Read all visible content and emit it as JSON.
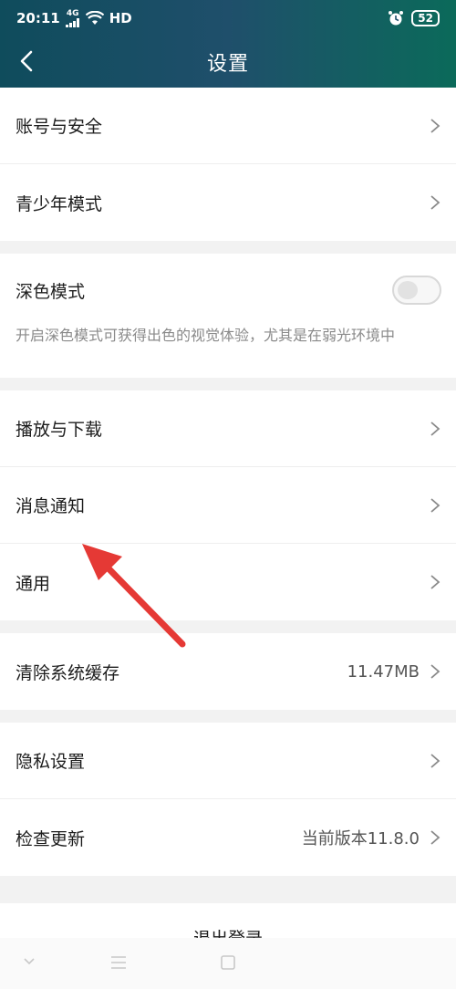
{
  "status_bar": {
    "time": "20:11",
    "network": "4G",
    "hd": "HD",
    "battery": "52"
  },
  "header": {
    "title": "设置"
  },
  "groups": [
    [
      {
        "label": "账号与安全"
      },
      {
        "label": "青少年模式"
      }
    ],
    [
      {
        "label": "播放与下载"
      },
      {
        "label": "消息通知"
      },
      {
        "label": "通用"
      }
    ]
  ],
  "dark_mode": {
    "label": "深色模式",
    "description": "开启深色模式可获得出色的视觉体验，尤其是在弱光环境中",
    "enabled": false
  },
  "cache": {
    "label": "清除系统缓存",
    "value": "11.47MB"
  },
  "privacy": {
    "label": "隐私设置"
  },
  "update": {
    "label": "检查更新",
    "value": "当前版本11.8.0"
  },
  "logout": {
    "label": "退出登录"
  },
  "colors": {
    "header_start": "#0f4c5c",
    "header_end": "#0b6a5a",
    "arrow": "#e53935"
  }
}
